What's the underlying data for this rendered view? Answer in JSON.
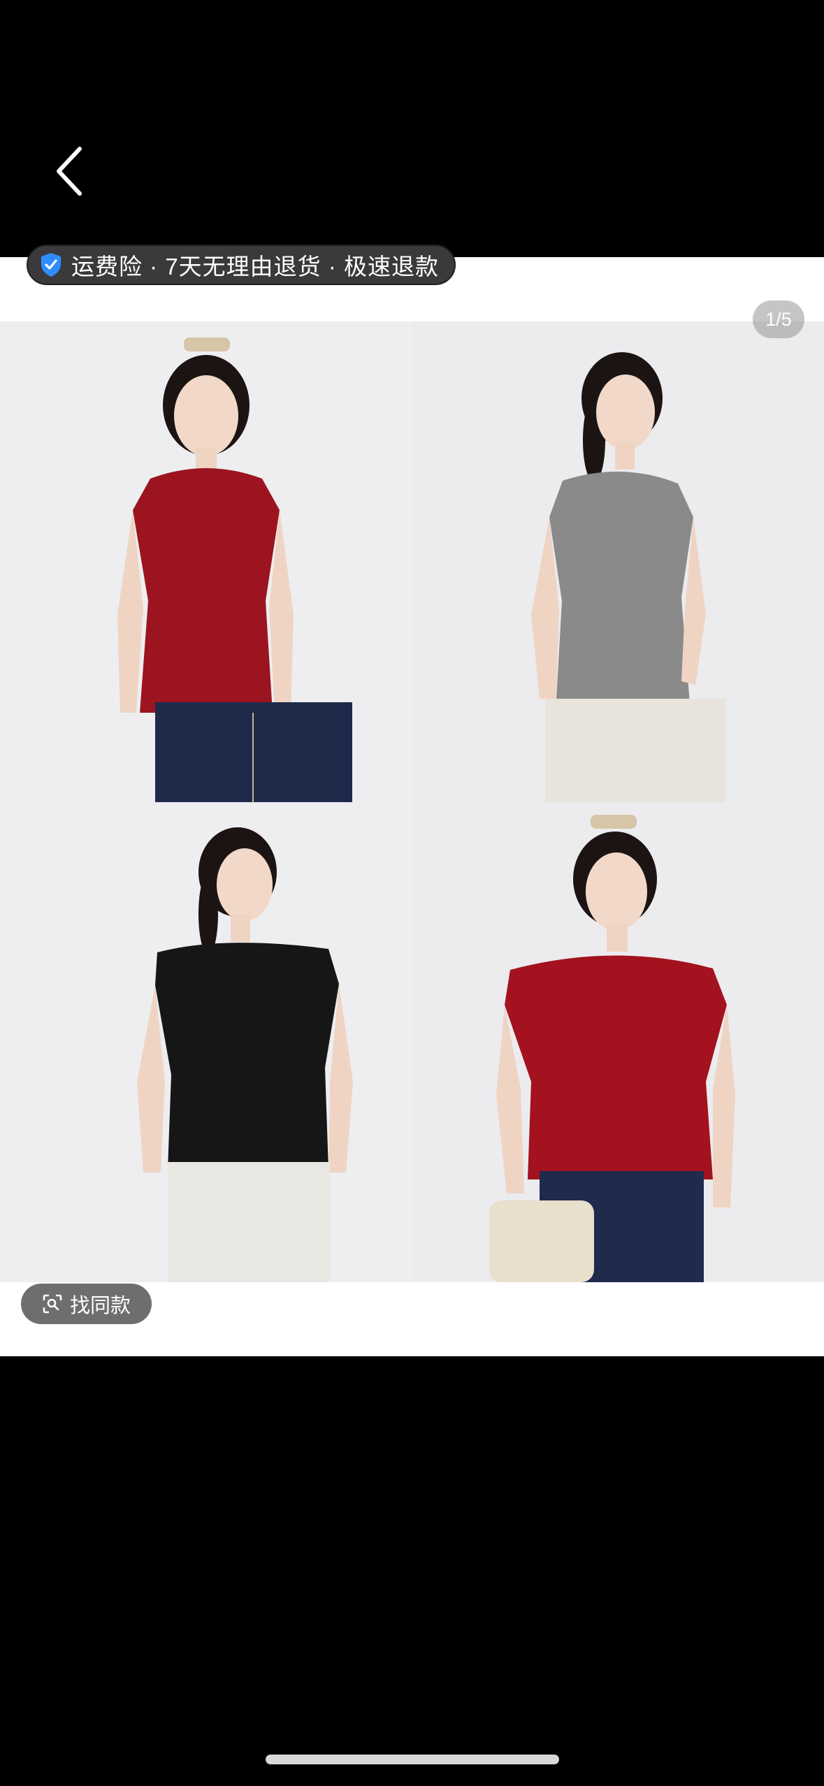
{
  "nav": {
    "back_icon": "chevron-left-icon"
  },
  "service_badge": {
    "icon": "shield-check-icon",
    "text": "运费险 · 7天无理由退货 · 极速退款",
    "icon_color": "#2f8cff"
  },
  "gallery": {
    "page_indicator": "1/5",
    "photos": [
      {
        "top_color": "#9b1420",
        "bottom_color": "#1e2a4a"
      },
      {
        "top_color": "#8a8a8a",
        "bottom_color": "#e8e4dc"
      },
      {
        "top_color": "#161616",
        "bottom_color": "#e9e7e2"
      },
      {
        "top_color": "#a3121e",
        "bottom_color": "#1f2b4d"
      }
    ]
  },
  "find_similar": {
    "icon": "scan-search-icon",
    "label": "找同款"
  },
  "colors": {
    "background": "#000000",
    "viewer_bg": "#ffffff"
  }
}
